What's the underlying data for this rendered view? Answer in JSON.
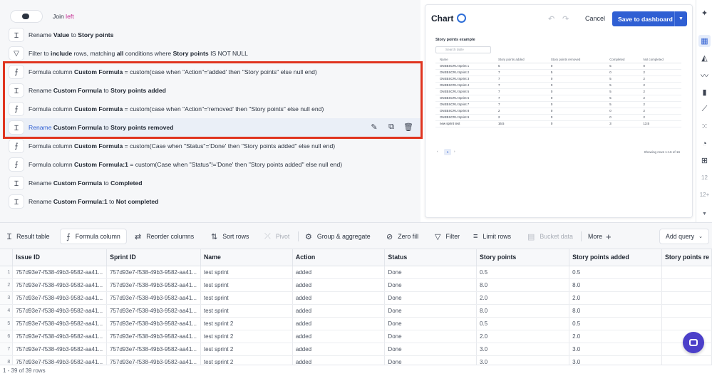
{
  "steps": [
    {
      "type": "join",
      "icon": "toggle-icon",
      "parts": [
        {
          "t": "Join "
        },
        {
          "t": "left",
          "lnk": true
        }
      ]
    },
    {
      "type": "rename",
      "icon": "rename-icon",
      "parts": [
        {
          "t": "Rename "
        },
        {
          "t": "Value",
          "b": true
        },
        {
          "t": " to "
        },
        {
          "t": "Story points",
          "b": true
        }
      ]
    },
    {
      "type": "filter",
      "icon": "filter-icon",
      "parts": [
        {
          "t": "Filter to "
        },
        {
          "t": "include",
          "b": true
        },
        {
          "t": " rows, matching "
        },
        {
          "t": "all",
          "b": true
        },
        {
          "t": " conditions where "
        },
        {
          "t": "Story points",
          "b": true
        },
        {
          "t": " IS NOT NULL"
        }
      ]
    },
    {
      "type": "formula",
      "icon": "formula-icon",
      "parts": [
        {
          "t": "Formula column   "
        },
        {
          "t": "Custom Formula",
          "b": true
        },
        {
          "t": "   =   custom(case when \"Action\"='added' then \"Story points\" else null end)"
        }
      ]
    },
    {
      "type": "rename",
      "icon": "rename-icon",
      "parts": [
        {
          "t": "Rename "
        },
        {
          "t": "Custom Formula",
          "b": true
        },
        {
          "t": " to "
        },
        {
          "t": "Story points added",
          "b": true
        }
      ]
    },
    {
      "type": "formula",
      "icon": "formula-icon",
      "parts": [
        {
          "t": "Formula column   "
        },
        {
          "t": "Custom Formula",
          "b": true
        },
        {
          "t": "   =   custom(case when \"Action\"='removed' then \"Story points\" else null end)"
        }
      ]
    },
    {
      "type": "rename",
      "icon": "rename-icon",
      "highlight": true,
      "parts": [
        {
          "t": "Rename ",
          "kw": true
        },
        {
          "t": "Custom Formula",
          "b": true
        },
        {
          "t": " to "
        },
        {
          "t": "Story points removed",
          "b": true
        }
      ]
    },
    {
      "type": "formula",
      "icon": "formula-icon",
      "parts": [
        {
          "t": "Formula column   "
        },
        {
          "t": "Custom Formula",
          "b": true
        },
        {
          "t": "   =   custom(Case when \"Status\"='Done' then \"Story points added\" else null end)"
        }
      ]
    },
    {
      "type": "formula",
      "icon": "formula-icon",
      "parts": [
        {
          "t": "Formula column   "
        },
        {
          "t": "Custom Formula:1",
          "b": true
        },
        {
          "t": "   =   custom(Case when \"Status\"!='Done' then \"Story points added\" else null end)"
        }
      ]
    },
    {
      "type": "rename",
      "icon": "rename-icon",
      "parts": [
        {
          "t": "Rename "
        },
        {
          "t": "Custom Formula",
          "b": true
        },
        {
          "t": " to "
        },
        {
          "t": "Completed",
          "b": true
        }
      ]
    },
    {
      "type": "rename",
      "icon": "rename-icon",
      "parts": [
        {
          "t": "Rename "
        },
        {
          "t": "Custom Formula:1",
          "b": true
        },
        {
          "t": " to "
        },
        {
          "t": "Not completed",
          "b": true
        }
      ]
    }
  ],
  "step_actions": {
    "edit_icon": "pencil-icon",
    "copy_icon": "copy-icon",
    "delete_icon": "trash-icon"
  },
  "chart": {
    "title": "Chart",
    "cancel_label": "Cancel",
    "save_label": "Save to dashboard",
    "mini_title": "Story points example",
    "search_placeholder": "Search table",
    "columns": [
      "Name",
      "Story points added",
      "Story points removed",
      "Completed",
      "Not completed"
    ],
    "rows": [
      [
        "ONEBSCRU Sprint 1",
        "5",
        "0",
        "5",
        "0"
      ],
      [
        "ONEBSCRU Sprint 2",
        "7",
        "5",
        "0",
        "2"
      ],
      [
        "ONEBSCRU Sprint 3",
        "7",
        "0",
        "5",
        "2"
      ],
      [
        "ONEBSCRU Sprint 4",
        "7",
        "0",
        "5",
        "2"
      ],
      [
        "ONEBSCRU Sprint 5",
        "7",
        "0",
        "5",
        "2"
      ],
      [
        "ONEBSCRU Sprint 6",
        "7",
        "0",
        "5",
        "2"
      ],
      [
        "ONEBSCRU Sprint 7",
        "7",
        "0",
        "5",
        "2"
      ],
      [
        "ONEBSCRU Sprint 8",
        "2",
        "0",
        "0",
        "2"
      ],
      [
        "ONEBSCRU Sprint 9",
        "2",
        "0",
        "0",
        "2"
      ]
    ],
    "total_row": [
      "new sprint test",
      "16.5",
      "0",
      "3",
      "13.5"
    ],
    "page": "1",
    "rows_info": "Showing rows 1-16 of 16"
  },
  "rail": {
    "num1": "12",
    "num2": "12+"
  },
  "toolbar": {
    "result_table": "Result table",
    "formula_column": "Formula column",
    "reorder_columns": "Reorder columns",
    "sort_rows": "Sort rows",
    "pivot": "Pivot",
    "group_aggregate": "Group & aggregate",
    "zero_fill": "Zero fill",
    "filter": "Filter",
    "limit_rows": "Limit rows",
    "bucket_data": "Bucket data",
    "more": "More",
    "add_query": "Add query"
  },
  "grid": {
    "columns": [
      "Issue ID",
      "Sprint ID",
      "Name",
      "Action",
      "Status",
      "Story points",
      "Story points added",
      "Story points re"
    ],
    "rows": [
      [
        "1",
        "757d93e7-f538-49b3-9582-aa41...",
        "757d93e7-f538-49b3-9582-aa41...",
        "test sprint",
        "added",
        "Done",
        "0.5",
        "0.5",
        ""
      ],
      [
        "2",
        "757d93e7-f538-49b3-9582-aa41...",
        "757d93e7-f538-49b3-9582-aa41...",
        "test sprint",
        "added",
        "Done",
        "8.0",
        "8.0",
        ""
      ],
      [
        "3",
        "757d93e7-f538-49b3-9582-aa41...",
        "757d93e7-f538-49b3-9582-aa41...",
        "test sprint",
        "added",
        "Done",
        "2.0",
        "2.0",
        ""
      ],
      [
        "4",
        "757d93e7-f538-49b3-9582-aa41...",
        "757d93e7-f538-49b3-9582-aa41...",
        "test sprint",
        "added",
        "Done",
        "8.0",
        "8.0",
        ""
      ],
      [
        "5",
        "757d93e7-f538-49b3-9582-aa41...",
        "757d93e7-f538-49b3-9582-aa41...",
        "test sprint 2",
        "added",
        "Done",
        "0.5",
        "0.5",
        ""
      ],
      [
        "6",
        "757d93e7-f538-49b3-9582-aa41...",
        "757d93e7-f538-49b3-9582-aa41...",
        "test sprint 2",
        "added",
        "Done",
        "2.0",
        "2.0",
        ""
      ],
      [
        "7",
        "757d93e7-f538-49b3-9582-aa41...",
        "757d93e7-f538-49b3-9582-aa41...",
        "test sprint 2",
        "added",
        "Done",
        "3.0",
        "3.0",
        ""
      ],
      [
        "8",
        "757d93e7-f538-49b3-9582-aa41...",
        "757d93e7-f538-49b3-9582-aa41...",
        "test sprint 2",
        "added",
        "Done",
        "3.0",
        "3.0",
        ""
      ]
    ]
  },
  "status": "1 - 39 of 39 rows",
  "colors": {
    "accent": "#2f5fd3",
    "highlight_border": "#e0341f",
    "chat_bubble": "#4b3fc9"
  }
}
